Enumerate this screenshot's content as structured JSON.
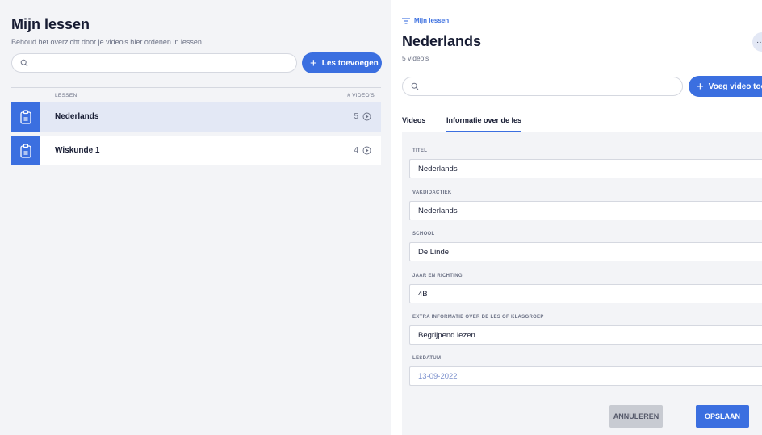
{
  "left": {
    "title": "Mijn lessen",
    "subtitle": "Behoud het overzicht door je video's hier ordenen in lessen",
    "search_placeholder": "",
    "add_button": "Les toevoegen",
    "columns": {
      "lessen": "LESSEN",
      "videos": "# VIDEO'S"
    },
    "lessons": [
      {
        "name": "Nederlands",
        "count": "5",
        "selected": true
      },
      {
        "name": "Wiskunde 1",
        "count": "4",
        "selected": false
      }
    ]
  },
  "right": {
    "breadcrumb": "Mijn lessen",
    "title": "Nederlands",
    "subtitle": "5 video's",
    "more_label": "··",
    "search_placeholder": "",
    "add_video_button": "Voeg video toe",
    "tabs": [
      {
        "label": "Videos",
        "active": false
      },
      {
        "label": "Informatie over de les",
        "active": true
      }
    ],
    "fields": [
      {
        "label": "TITEL",
        "value": "Nederlands"
      },
      {
        "label": "VAKDIDACTIEK",
        "value": "Nederlands"
      },
      {
        "label": "SCHOOL",
        "value": "De Linde"
      },
      {
        "label": "JAAR EN RICHTING",
        "value": "4B"
      },
      {
        "label": "EXTRA INFORMATIE OVER DE LES OF KLASGROEP",
        "value": "Begrijpend lezen"
      },
      {
        "label": "LESDATUM",
        "value": "13-09-2022"
      }
    ],
    "cancel_button": "ANNULEREN",
    "save_button": "OPSLAAN"
  },
  "colors": {
    "accent": "#3b6fe0",
    "background": "#f3f4f7",
    "selected_row": "#e3e8f5",
    "text": "#171c33",
    "muted": "#6b7185"
  },
  "icons": {
    "search": "search-icon",
    "plus": "plus-icon",
    "lesson": "clipboard-icon",
    "play": "play-circle-icon",
    "filter": "filter-lines-icon",
    "more": "more-icon"
  }
}
